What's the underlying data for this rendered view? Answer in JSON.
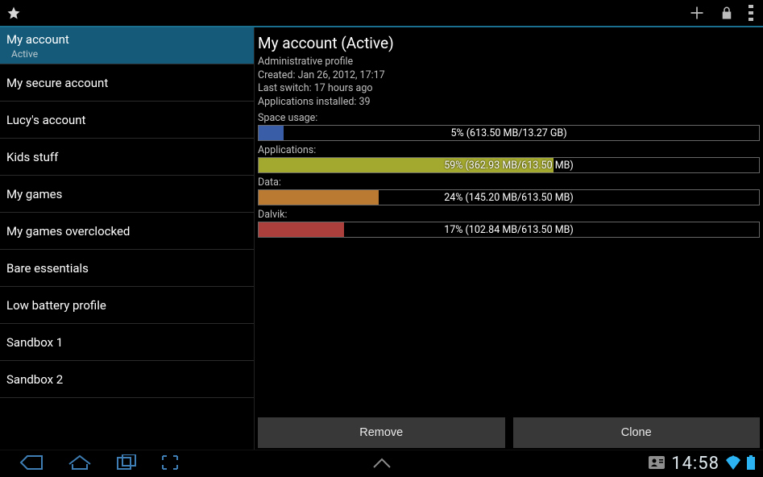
{
  "sidebar": {
    "items": [
      {
        "label": "My account",
        "sub": "Active",
        "selected": true
      },
      {
        "label": "My secure account"
      },
      {
        "label": "Lucy's account"
      },
      {
        "label": "Kids stuff"
      },
      {
        "label": "My games"
      },
      {
        "label": "My games overclocked"
      },
      {
        "label": "Bare essentials"
      },
      {
        "label": "Low battery profile"
      },
      {
        "label": "Sandbox 1"
      },
      {
        "label": "Sandbox 2"
      }
    ]
  },
  "content": {
    "title": "My account (Active)",
    "meta": {
      "profileType": "Administrative profile",
      "created": "Created: Jan 26, 2012, 17:17",
      "lastSwitch": "Last switch: 17 hours ago",
      "appsInstalled": "Applications installed: 39"
    },
    "bars": {
      "spaceUsage": {
        "label": "Space usage:",
        "text": "5% (613.50 MB/13.27 GB)",
        "percent": 5,
        "color": "#3a5da8"
      },
      "applications": {
        "label": "Applications:",
        "text": "59% (362.93 MB/613.50 MB)",
        "percent": 59,
        "color": "#a3a82f"
      },
      "data": {
        "label": "Data:",
        "text": "24% (145.20 MB/613.50 MB)",
        "percent": 24,
        "color": "#ba7a31"
      },
      "dalvik": {
        "label": "Dalvik:",
        "text": "17% (102.84 MB/613.50 MB)",
        "percent": 17,
        "color": "#aa3f3c"
      }
    },
    "buttons": {
      "remove": "Remove",
      "clone": "Clone"
    }
  },
  "statusBar": {
    "clock": "14:58"
  }
}
